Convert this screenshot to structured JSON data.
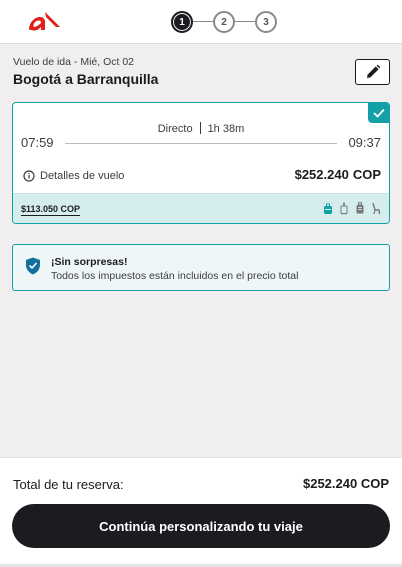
{
  "header": {
    "logo_icon": "avianca-logo-icon",
    "brand_color": "#e0201b",
    "steps": [
      {
        "label": "1",
        "active": true
      },
      {
        "label": "2",
        "active": false
      },
      {
        "label": "3",
        "active": false
      }
    ]
  },
  "flight": {
    "subtitle": "Vuelo de ida - Mié, Oct 02",
    "route": "Bogotá a Barranquilla",
    "edit_icon": "pencil-icon",
    "card": {
      "selected_icon": "check-icon",
      "type": "Directo",
      "duration": "1h 38m",
      "departure": "07:59",
      "arrival": "09:37",
      "details_label": "Detalles de vuelo",
      "details_icon": "info-icon",
      "price": "$252.240",
      "currency": "COP",
      "old_price": "$113.050 COP",
      "amenity_icons": [
        "personal-item-icon",
        "carry-on-icon",
        "checked-bag-icon",
        "seat-icon"
      ],
      "accent_color": "#13a0a6"
    }
  },
  "notice": {
    "icon": "shield-check-icon",
    "title": "¡Sin sorpresas!",
    "text": "Todos los impuestos están incluidos en el precio total"
  },
  "footer": {
    "total_label": "Total de tu reserva:",
    "total_price": "$252.240 COP",
    "cta_label": "Continúa personalizando tu viaje"
  }
}
